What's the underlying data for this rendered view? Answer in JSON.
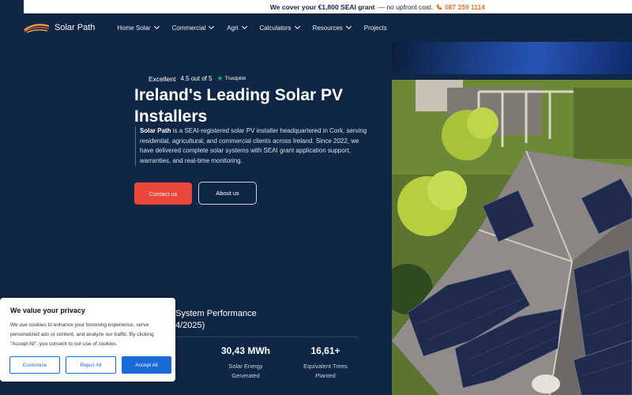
{
  "topbar": {
    "message": "We cover your €1,800 SEAI grant",
    "message_suffix": "— no upfront cost.",
    "phone": "087 259 1114"
  },
  "nav": {
    "logo": "Solar Path",
    "items": [
      {
        "label": "Home Solar",
        "has_dropdown": true
      },
      {
        "label": "Commercial",
        "has_dropdown": true
      },
      {
        "label": "Agri",
        "has_dropdown": true
      },
      {
        "label": "Calculators",
        "has_dropdown": true
      },
      {
        "label": "Resources",
        "has_dropdown": true
      },
      {
        "label": "Projects",
        "has_dropdown": false
      }
    ]
  },
  "trust": {
    "rating_word": "Excellent",
    "score": "4.5 out of 5",
    "brand": "Trustpilot"
  },
  "hero": {
    "title": "Ireland's Leading Solar PV Installers",
    "intro_bold": "Solar Path",
    "intro_text": " is a SEAI-registered solar PV installer headquartered in Cork, serving residential, agricultural, and commercial clients across Ireland. Since 2022, we have delivered complete solar systems with SEAI grant application support, warranties, and real-time monitoring.",
    "contact_label": "Contact us",
    "about_label": "About us"
  },
  "performance": {
    "title_line1": "System Performance",
    "title_line2": "4/2025)",
    "stats": [
      {
        "value": "30,43 MWh",
        "label_line1": "Solar Energy",
        "label_line2": "Generated"
      },
      {
        "value": "16,61+",
        "label_line1": "Equivalent Trees",
        "label_line2": "Planted"
      }
    ]
  },
  "cookie": {
    "title": "We value your privacy",
    "body": "We use cookies to enhance your browsing experience, serve personalized ads or content, and analyze our traffic. By clicking \"Accept All\", you consent to our use of cookies.",
    "customize": "Customize",
    "reject": "Reject All",
    "accept": "Accept All"
  },
  "colors": {
    "background": "#0f2744",
    "accent_red": "#e9473a",
    "cookie_blue": "#1a6ad8",
    "phone_orange": "#e0762a",
    "trustpilot_green": "#00b67a"
  }
}
